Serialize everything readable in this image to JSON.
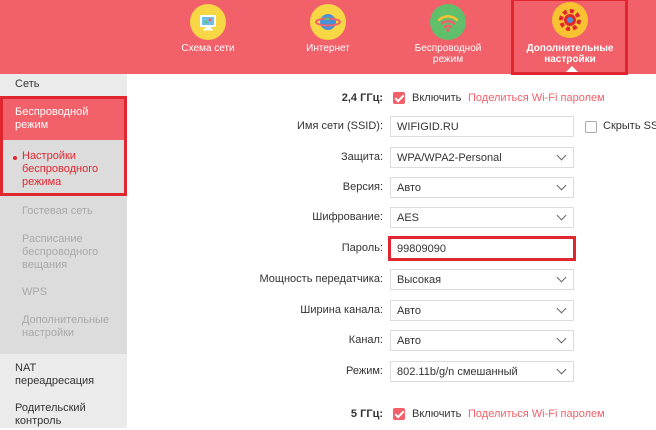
{
  "nav": {
    "items": [
      {
        "label": "Схема сети",
        "icon": "network-map-icon"
      },
      {
        "label": "Интернет",
        "icon": "globe-icon"
      },
      {
        "label": "Беспроводной режим",
        "icon": "wifi-icon"
      },
      {
        "label": "Дополнительные настройки",
        "icon": "gear-icon"
      }
    ]
  },
  "sidebar": {
    "net": "Сеть",
    "wireless": "Беспроводной режим",
    "subitems": [
      "Настройки беспроводного режима",
      "Гостевая сеть",
      "Расписание беспроводного вещания",
      "WPS",
      "Дополнительные настройки"
    ],
    "nat": "NAT переадресация",
    "parental": "Родительский контроль"
  },
  "form": {
    "band24": {
      "label": "2,4 ГГц:",
      "enable": "Включить",
      "share": "Поделиться Wi-Fi паролем"
    },
    "ssid": {
      "label": "Имя сети (SSID):",
      "value": "WIFIGID.RU",
      "hide": "Скрыть SS"
    },
    "security": {
      "label": "Защита:",
      "value": "WPA/WPA2-Personal"
    },
    "version": {
      "label": "Версия:",
      "value": "Авто"
    },
    "encryption": {
      "label": "Шифрование:",
      "value": "AES"
    },
    "password": {
      "label": "Пароль:",
      "value": "99809090"
    },
    "power": {
      "label": "Мощность передатчика:",
      "value": "Высокая"
    },
    "width": {
      "label": "Ширина канала:",
      "value": "Авто"
    },
    "channel": {
      "label": "Канал:",
      "value": "Авто"
    },
    "mode": {
      "label": "Режим:",
      "value": "802.11b/g/n смешанный"
    },
    "band5": {
      "label": "5 ГГц:",
      "enable": "Включить",
      "share": "Поделиться Wi-Fi паролем"
    }
  },
  "colors": {
    "accent": "#f2606a",
    "highlight": "#e0262f",
    "sidebar": "#ebebeb"
  }
}
